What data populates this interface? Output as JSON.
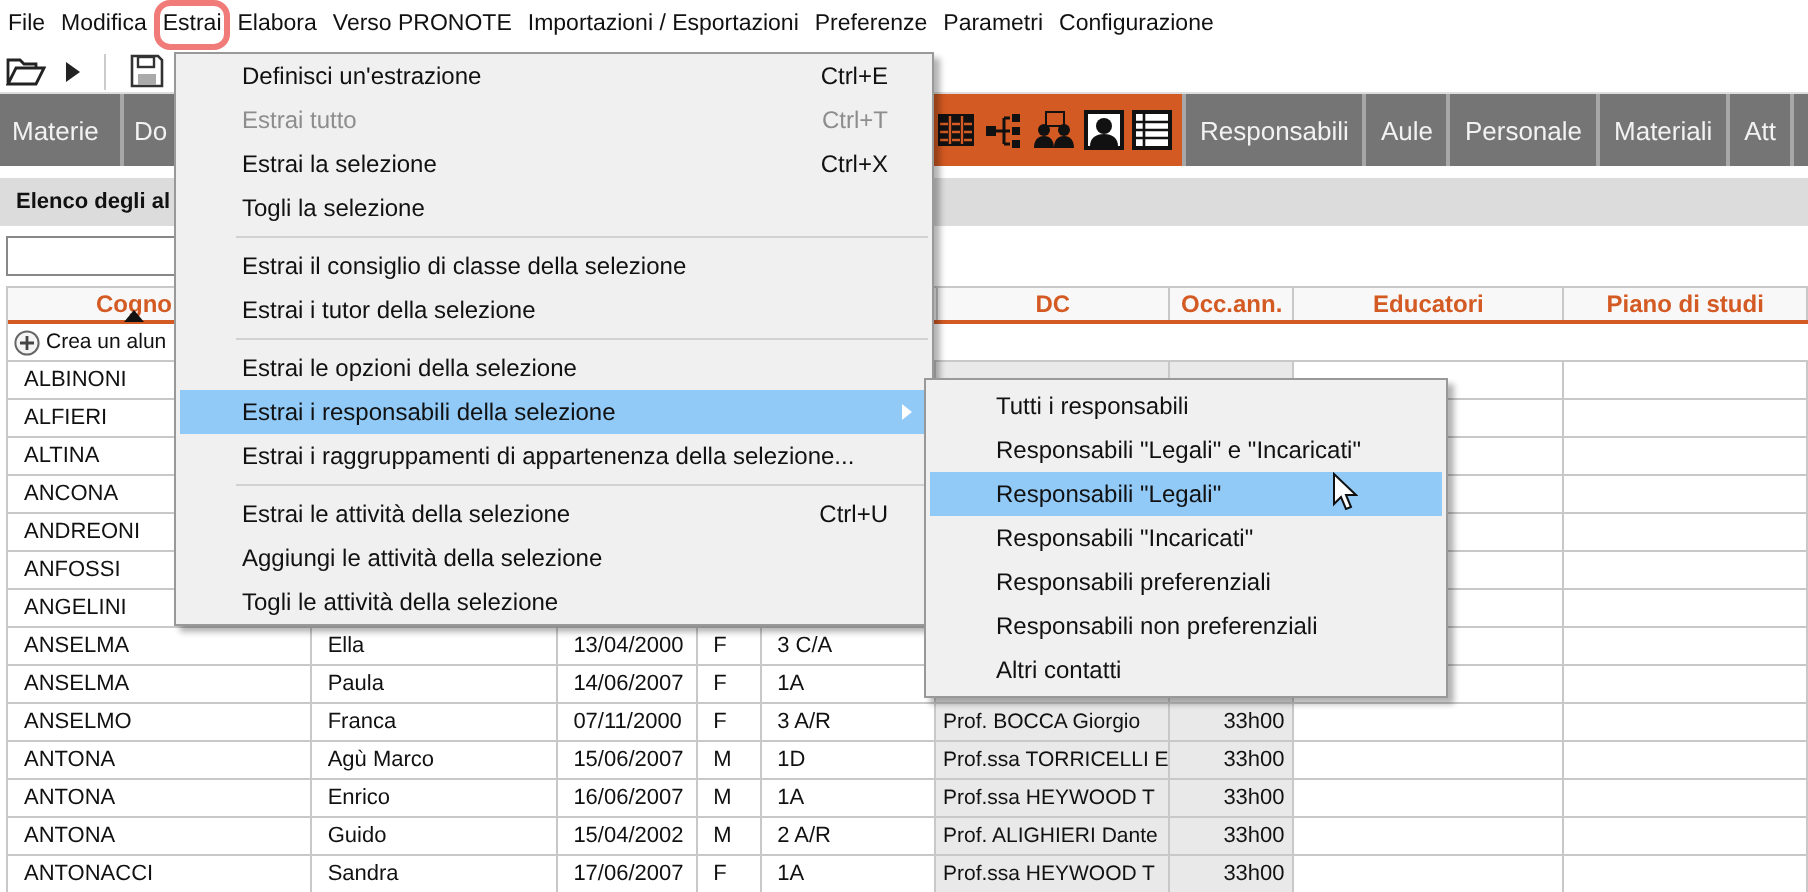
{
  "menubar": {
    "items": [
      {
        "label": "File",
        "selected": false
      },
      {
        "label": "Modifica",
        "selected": false
      },
      {
        "label": "Estrai",
        "selected": true
      },
      {
        "label": "Elabora",
        "selected": false
      },
      {
        "label": "Verso PRONOTE",
        "selected": false
      },
      {
        "label": "Importazioni / Esportazioni",
        "selected": false
      },
      {
        "label": "Preferenze",
        "selected": false
      },
      {
        "label": "Parametri",
        "selected": false
      },
      {
        "label": "Configurazione",
        "selected": false
      }
    ]
  },
  "toolbar": {
    "items": [
      {
        "kind": "open"
      },
      {
        "kind": "next"
      },
      {
        "kind": "separator"
      },
      {
        "kind": "save"
      }
    ]
  },
  "tabs": [
    {
      "kind": "text",
      "label": "Materie",
      "selected": false
    },
    {
      "kind": "text",
      "label": "Do",
      "selected": false
    },
    {
      "kind": "icons",
      "selected": true
    },
    {
      "kind": "text",
      "label": "Responsabili",
      "selected": false
    },
    {
      "kind": "text",
      "label": "Aule",
      "selected": false
    },
    {
      "kind": "text",
      "label": "Personale",
      "selected": false
    },
    {
      "kind": "text",
      "label": "Materiali",
      "selected": false
    },
    {
      "kind": "text",
      "label": "Att",
      "selected": false
    }
  ],
  "panel": {
    "title": "Elenco degli al"
  },
  "table": {
    "columns": [
      {
        "label": "Cogno",
        "sorted": true
      },
      null,
      null,
      null,
      null,
      {
        "label": "DC",
        "sorted": false
      },
      {
        "label": "Occ.ann.",
        "sorted": false
      },
      {
        "label": "Educatori",
        "sorted": false
      },
      {
        "label": "Piano di studi",
        "sorted": false
      }
    ],
    "create_row": {
      "label": "Crea un alun"
    },
    "rows": [
      {
        "cells": [
          "ALBINONI",
          null,
          null,
          null,
          null,
          null,
          null,
          null,
          null
        ]
      },
      {
        "cells": [
          "ALFIERI",
          null,
          null,
          null,
          null,
          null,
          null,
          null,
          null
        ]
      },
      {
        "cells": [
          "ALTINA",
          null,
          null,
          null,
          null,
          null,
          null,
          null,
          null
        ]
      },
      {
        "cells": [
          "ANCONA",
          null,
          null,
          null,
          null,
          null,
          null,
          null,
          null
        ]
      },
      {
        "cells": [
          "ANDREONI",
          null,
          null,
          null,
          null,
          null,
          null,
          null,
          null
        ]
      },
      {
        "cells": [
          "ANFOSSI",
          null,
          null,
          null,
          null,
          null,
          null,
          null,
          null
        ]
      },
      {
        "cells": [
          "ANGELINI",
          null,
          null,
          null,
          null,
          null,
          null,
          null,
          null
        ]
      },
      {
        "cells": [
          "ANSELMA",
          "Ella",
          "13/04/2000",
          "F",
          "3 C/A",
          null,
          null,
          null,
          null
        ]
      },
      {
        "cells": [
          "ANSELMA",
          "Paula",
          "14/06/2007",
          "F",
          "1A",
          null,
          null,
          null,
          null
        ]
      },
      {
        "cells": [
          "ANSELMO",
          "Franca",
          "07/11/2000",
          "F",
          "3 A/R",
          "Prof. BOCCA Giorgio",
          "33h00",
          null,
          null
        ]
      },
      {
        "cells": [
          "ANTONA",
          "Agù Marco",
          "15/06/2007",
          "M",
          "1D",
          "Prof.ssa TORRICELLI E",
          "33h00",
          null,
          null
        ]
      },
      {
        "cells": [
          "ANTONA",
          "Enrico",
          "16/06/2007",
          "M",
          "1A",
          "Prof.ssa HEYWOOD T",
          "33h00",
          null,
          null
        ]
      },
      {
        "cells": [
          "ANTONA",
          "Guido",
          "15/04/2002",
          "M",
          "2 A/R",
          "Prof. ALIGHIERI Dante",
          "33h00",
          null,
          null
        ]
      },
      {
        "cells": [
          "ANTONACCI",
          "Sandra",
          "17/06/2007",
          "F",
          "1A",
          "Prof.ssa HEYWOOD T",
          "33h00",
          null,
          null
        ]
      }
    ]
  },
  "menu": {
    "items": [
      {
        "kind": "item",
        "label": "Definisci un'estrazione",
        "shortcut": "Ctrl+E",
        "disabled": false,
        "has_submenu": false,
        "selected": false
      },
      {
        "kind": "item",
        "label": "Estrai tutto",
        "shortcut": "Ctrl+T",
        "disabled": true,
        "has_submenu": false,
        "selected": false
      },
      {
        "kind": "item",
        "label": "Estrai la selezione",
        "shortcut": "Ctrl+X",
        "disabled": false,
        "has_submenu": false,
        "selected": false
      },
      {
        "kind": "item",
        "label": "Togli la selezione",
        "disabled": false,
        "has_submenu": false,
        "selected": false
      },
      {
        "kind": "separator"
      },
      {
        "kind": "item",
        "label": "Estrai il consiglio di classe della selezione",
        "disabled": false,
        "has_submenu": false,
        "selected": false
      },
      {
        "kind": "item",
        "label": "Estrai i tutor della selezione",
        "disabled": false,
        "has_submenu": false,
        "selected": false
      },
      {
        "kind": "separator"
      },
      {
        "kind": "item",
        "label": "Estrai le opzioni della selezione",
        "disabled": false,
        "has_submenu": false,
        "selected": false
      },
      {
        "kind": "item",
        "label": "Estrai i responsabili della selezione",
        "disabled": false,
        "has_submenu": true,
        "selected": true
      },
      {
        "kind": "item",
        "label": "Estrai i raggruppamenti di appartenenza della selezione...",
        "disabled": false,
        "has_submenu": false,
        "selected": false
      },
      {
        "kind": "separator"
      },
      {
        "kind": "item",
        "label": "Estrai le attività della selezione",
        "shortcut": "Ctrl+U",
        "disabled": false,
        "has_submenu": false,
        "selected": false
      },
      {
        "kind": "item",
        "label": "Aggiungi le attività della selezione",
        "disabled": false,
        "has_submenu": false,
        "selected": false
      },
      {
        "kind": "item",
        "label": "Togli le attività della selezione",
        "disabled": false,
        "has_submenu": false,
        "selected": false
      }
    ]
  },
  "submenu": {
    "items": [
      {
        "label": "Tutti i responsabili",
        "selected": false
      },
      {
        "label": "Responsabili \"Legali\" e \"Incaricati\"",
        "selected": false
      },
      {
        "label": "Responsabili \"Legali\"",
        "selected": true
      },
      {
        "label": "Responsabili \"Incaricati\"",
        "selected": false
      },
      {
        "label": "Responsabili preferenziali",
        "selected": false
      },
      {
        "label": "Responsabili non preferenziali",
        "selected": false
      },
      {
        "label": "Altri contatti",
        "selected": false
      }
    ]
  }
}
